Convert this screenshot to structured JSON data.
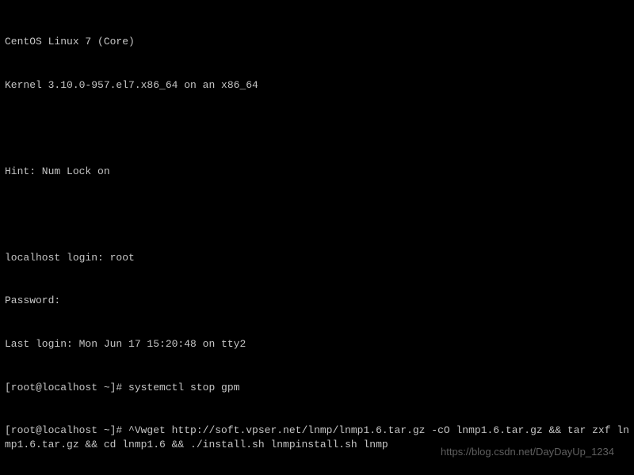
{
  "terminal": {
    "line1": "CentOS Linux 7 (Core)",
    "line2": "Kernel 3.10.0-957.el7.x86_64 on an x86_64",
    "line3": "Hint: Num Lock on",
    "line4": "localhost login: root",
    "line5": "Password:",
    "line6": "Last login: Mon Jun 17 15:20:48 on tty2",
    "line7": "[root@localhost ~]# systemctl stop gpm",
    "line8": "[root@localhost ~]# ^Vwget http://soft.vpser.net/lnmp/lnmp1.6.tar.gz -cO lnmp1.6.tar.gz && tar zxf lnmp1.6.tar.gz && cd lnmp1.6 && ./install.sh lnmpinstall.sh lnmp"
  },
  "watermark": "https://blog.csdn.net/DayDayUp_1234"
}
